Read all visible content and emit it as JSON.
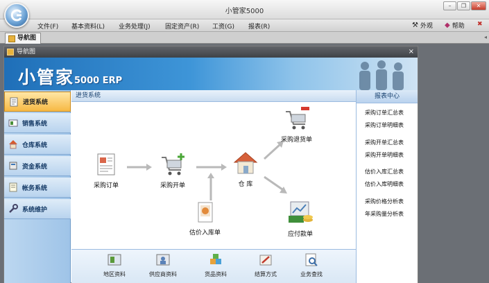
{
  "window": {
    "title": "小管家5000"
  },
  "menu": [
    {
      "label": "文件(F)"
    },
    {
      "label": "基本资料(L)"
    },
    {
      "label": "业务处理(J)"
    },
    {
      "label": "固定资产(R)"
    },
    {
      "label": "工资(G)"
    },
    {
      "label": "报表(R)"
    }
  ],
  "menu_right": {
    "appearance": "外观",
    "help": "帮助"
  },
  "tab": {
    "label": "导航图"
  },
  "panel": {
    "title": "导航图"
  },
  "banner": {
    "title": "小管家",
    "subtitle": "5000 ERP"
  },
  "sidebar": {
    "items": [
      {
        "label": "进货系统",
        "icon": "purchase-icon"
      },
      {
        "label": "销售系统",
        "icon": "sales-icon"
      },
      {
        "label": "仓库系统",
        "icon": "warehouse-icon"
      },
      {
        "label": "资金系统",
        "icon": "funds-icon"
      },
      {
        "label": "帐务系统",
        "icon": "ledger-icon"
      },
      {
        "label": "系统维护",
        "icon": "wrench-icon"
      }
    ]
  },
  "section": {
    "title": "进货系统"
  },
  "flow": {
    "purchase_order": "采购订单",
    "purchase_invoice": "采购开单",
    "warehouse": "仓  库",
    "purchase_return": "采购退货单",
    "estimate_inbound": "估价入库单",
    "payment": "应付款单"
  },
  "bottom_tools": [
    {
      "label": "地区资料"
    },
    {
      "label": "供应商资料"
    },
    {
      "label": "货品资料"
    },
    {
      "label": "结算方式"
    },
    {
      "label": "业务查找"
    }
  ],
  "report_center": {
    "title": "报表中心",
    "items": [
      {
        "label": "采购订单汇总表"
      },
      {
        "label": "采购订单明细表"
      },
      {
        "label": "采购开单汇总表"
      },
      {
        "label": "采购开单明细表"
      },
      {
        "label": "估价入库汇总表"
      },
      {
        "label": "估价入库明细表"
      },
      {
        "label": "采购价格分析表"
      },
      {
        "label": "年采购量分析表"
      }
    ]
  },
  "colors": {
    "active_tab": "#f7b944",
    "banner": "#2b7fc6"
  }
}
